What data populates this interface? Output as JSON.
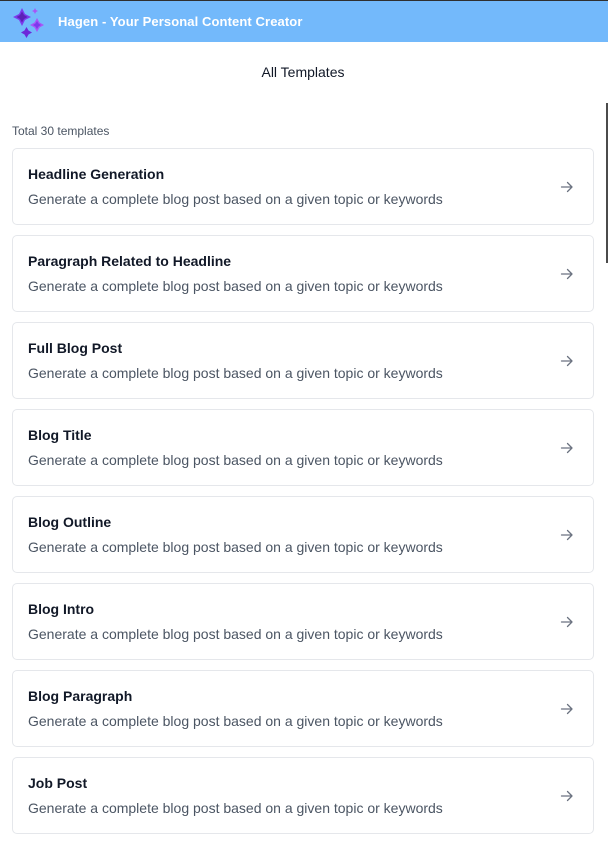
{
  "app": {
    "title": "Hagen - Your Personal Content Creator",
    "icon": "sparkles-logo-icon",
    "colors": {
      "titlebar": "#73b9fb",
      "logo_primary": "#7c3aed",
      "logo_secondary": "#a855f7"
    }
  },
  "page": {
    "heading": "All Templates",
    "total_label": "Total 30 templates"
  },
  "templates": [
    {
      "title": "Headline Generation",
      "description": "Generate a complete blog post based on a given topic or keywords",
      "icon": "arrow-right-icon"
    },
    {
      "title": "Paragraph Related to Headline",
      "description": "Generate a complete blog post based on a given topic or keywords",
      "icon": "arrow-right-icon"
    },
    {
      "title": "Full Blog Post",
      "description": "Generate a complete blog post based on a given topic or keywords",
      "icon": "arrow-right-icon"
    },
    {
      "title": "Blog Title",
      "description": "Generate a complete blog post based on a given topic or keywords",
      "icon": "arrow-right-icon"
    },
    {
      "title": "Blog Outline",
      "description": "Generate a complete blog post based on a given topic or keywords",
      "icon": "arrow-right-icon"
    },
    {
      "title": "Blog Intro",
      "description": "Generate a complete blog post based on a given topic or keywords",
      "icon": "arrow-right-icon"
    },
    {
      "title": "Blog Paragraph",
      "description": "Generate a complete blog post based on a given topic or keywords",
      "icon": "arrow-right-icon"
    },
    {
      "title": "Job Post",
      "description": "Generate a complete blog post based on a given topic or keywords",
      "icon": "arrow-right-icon"
    }
  ]
}
